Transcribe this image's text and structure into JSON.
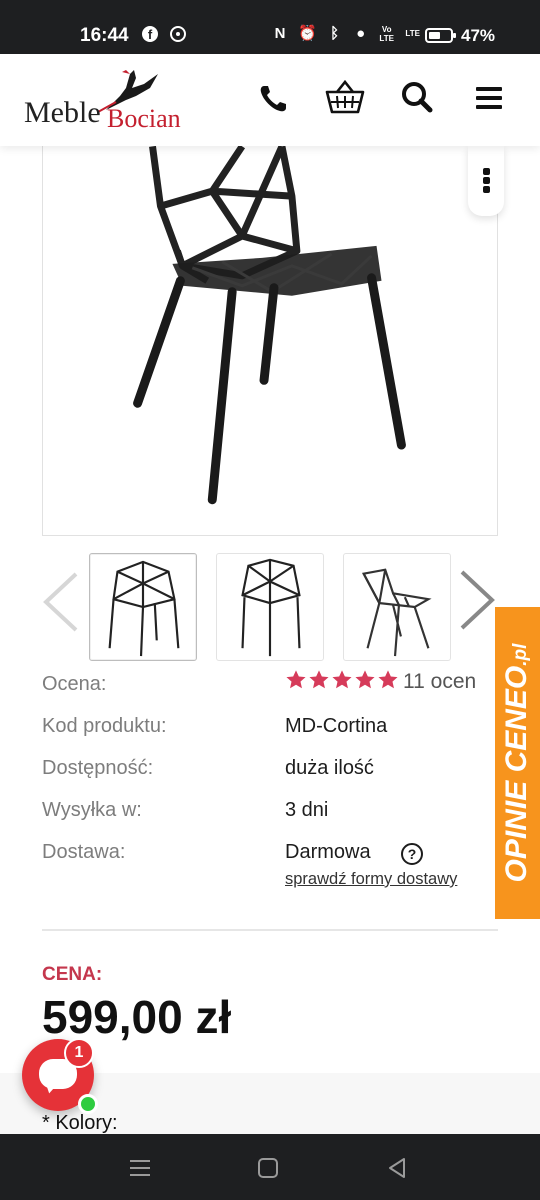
{
  "status_bar": {
    "time": "16:44",
    "battery": "47%",
    "icons": [
      "facebook-icon",
      "podcast-icon",
      "nfc-icon",
      "alarm-icon",
      "bluetooth-icon",
      "location-icon",
      "volte-icon",
      "signal-icon",
      "battery-icon"
    ],
    "volte_label": "Vo LTE",
    "lte_label": "LTE"
  },
  "header": {
    "logo_word1": "Meble",
    "logo_word2": "Bocian",
    "icons": [
      "phone-icon",
      "basket-icon",
      "search-icon",
      "menu-icon"
    ]
  },
  "product": {
    "thumbnails_count": 3,
    "specs": [
      {
        "label": "Ocena:",
        "value": ""
      },
      {
        "label": "Kod produktu:",
        "value": "MD-Cortina"
      },
      {
        "label": "Dostępność:",
        "value": "duża ilość"
      },
      {
        "label": "Wysyłka w:",
        "value": "3 dni"
      },
      {
        "label": "Dostawa:",
        "value": "Darmowa"
      }
    ],
    "rating_stars": 5,
    "rating_count": "11 ocen",
    "delivery_link": "sprawdź formy dostawy",
    "help_symbol": "?",
    "price_label": "CENA:",
    "price": "599,00 zł",
    "colors_label": "* Kolory:"
  },
  "ceneo_tab": {
    "text": "OPINIE CENEO",
    "suffix": ".pl",
    "color": "#f7941d"
  },
  "chat": {
    "badge": "1",
    "color": "#e53238"
  },
  "colors": {
    "accent": "#c4374d",
    "star": "#d63b5a",
    "brand_red": "#c4202f"
  }
}
